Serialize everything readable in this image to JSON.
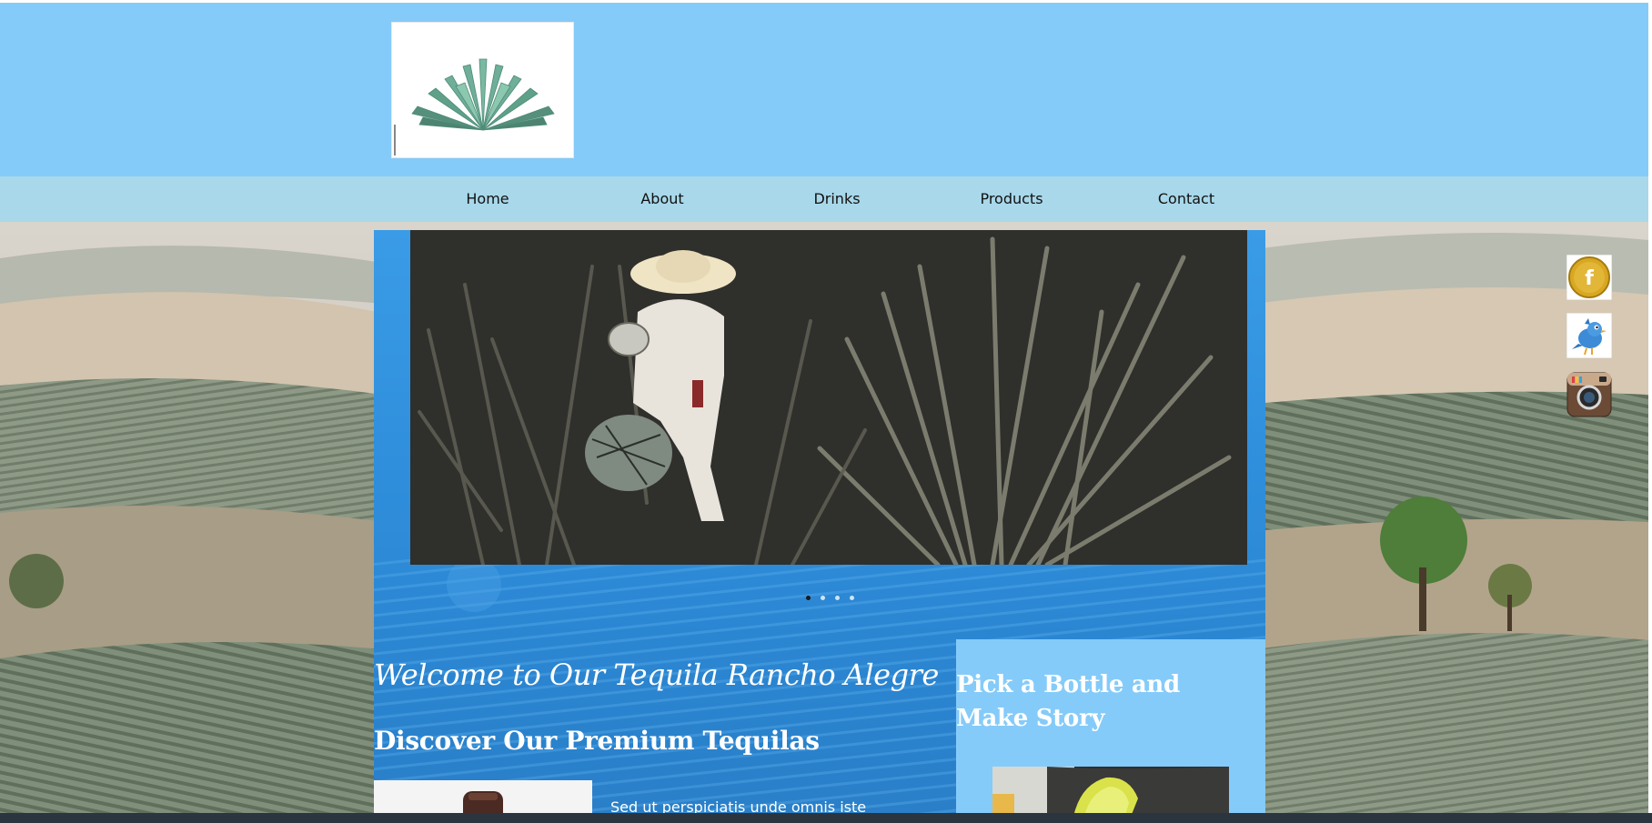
{
  "header": {
    "logo_icon": "agave-plant-logo"
  },
  "nav": {
    "items": [
      {
        "label": "Home"
      },
      {
        "label": "About"
      },
      {
        "label": "Drinks"
      },
      {
        "label": "Products"
      },
      {
        "label": "Contact"
      }
    ]
  },
  "slider": {
    "image_icon": "agave-harvester-photo",
    "dot_count": 4,
    "active_index": 0
  },
  "main": {
    "welcome": "Welcome to Our Tequila Rancho Alegre",
    "heading": "Discover Our Premium Tequilas",
    "intro_text": "Sed ut perspiciatis unde omnis iste"
  },
  "sidebar": {
    "title": "Pick a Bottle and Make Story",
    "image_icon": "tequila-shot-lime-photo"
  },
  "social": [
    {
      "icon": "facebook-icon",
      "letter": "f"
    },
    {
      "icon": "twitter-bird-icon"
    },
    {
      "icon": "instagram-icon"
    }
  ],
  "colors": {
    "header_bg": "#85cbf9",
    "nav_bg": "#a8d8ea",
    "main_bg": "#2f8fdc",
    "sidebar_bg": "#85cbf9"
  }
}
